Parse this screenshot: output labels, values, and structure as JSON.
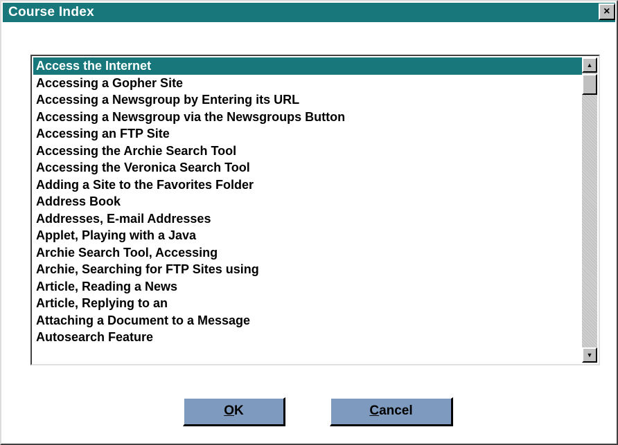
{
  "window": {
    "title": "Course Index",
    "close_glyph": "×",
    "accent_color": "#17777a"
  },
  "list": {
    "items": [
      "Access the Internet",
      "Accessing a Gopher Site",
      "Accessing a Newsgroup by Entering its URL",
      "Accessing a Newsgroup via the Newsgroups Button",
      "Accessing an FTP Site",
      "Accessing the Archie Search Tool",
      "Accessing the Veronica Search Tool",
      "Adding a Site to the Favorites Folder",
      "Address Book",
      "Addresses, E-mail Addresses",
      "Applet, Playing with a Java",
      "Archie Search Tool, Accessing",
      "Archie, Searching for FTP Sites using",
      "Article, Reading a News",
      "Article, Replying to an",
      "Attaching a Document to a Message",
      "Autosearch Feature"
    ],
    "selected_index": 0
  },
  "buttons": {
    "ok": {
      "mnemonic": "O",
      "rest": "K",
      "color": "#7e9bbf"
    },
    "cancel": {
      "mnemonic": "C",
      "rest": "ancel",
      "color": "#7e9bbf"
    }
  },
  "icons": {
    "close": "close-icon",
    "scroll_up": "scroll-up-arrow-icon",
    "scroll_down": "scroll-down-arrow-icon"
  }
}
